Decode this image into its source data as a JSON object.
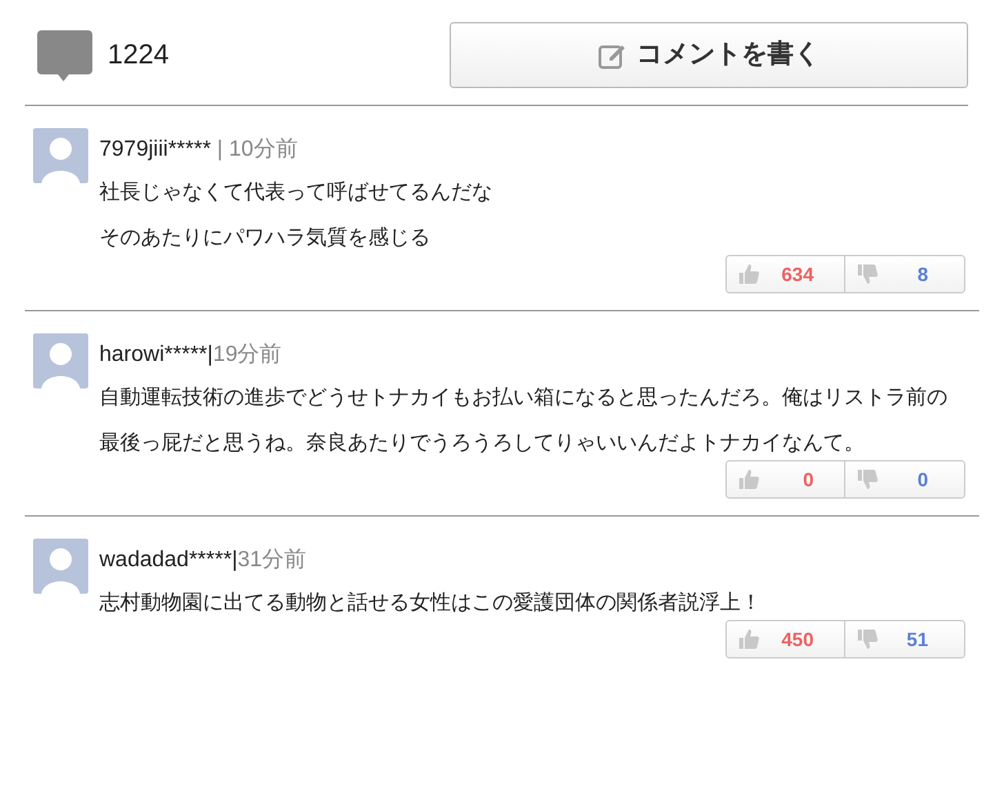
{
  "header": {
    "comment_count": "1224",
    "write_button": "コメントを書く"
  },
  "comments": [
    {
      "user": "7979jiii*****",
      "separator": " | ",
      "time": "10分前",
      "lines": [
        "社長じゃなくて代表って呼ばせてるんだな",
        "そのあたりにパワハラ気質を感じる"
      ],
      "likes": "634",
      "dislikes": "8"
    },
    {
      "user": "harowi*****",
      "separator": "|",
      "time": "19分前",
      "lines": [
        "自動運転技術の進歩でどうせトナカイもお払い箱になると思ったんだろ。俺はリストラ前の最後っ屁だと思うね。奈良あたりでうろうろしてりゃいいんだよトナカイなんて。"
      ],
      "likes": "0",
      "dislikes": "0"
    },
    {
      "user": "wadadad*****",
      "separator": "|",
      "time": "31分前",
      "lines": [
        "志村動物園に出てる動物と話せる女性はこの愛護団体の関係者説浮上！"
      ],
      "likes": "450",
      "dislikes": "51"
    }
  ]
}
